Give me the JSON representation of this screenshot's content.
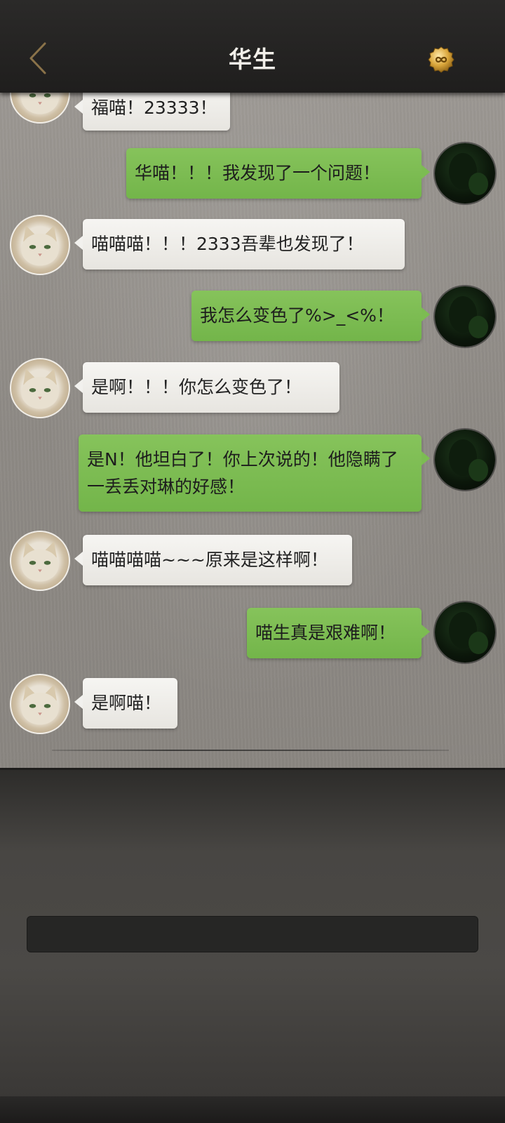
{
  "header": {
    "title": "华生",
    "back_icon": "back-chevron-icon",
    "coin_icon": "gold-infinity-coin-icon"
  },
  "colors": {
    "header_bg": "#232221",
    "chat_bg": "#95918c",
    "bubble_left": "#f2f1ee",
    "bubble_right": "#7cbc52",
    "back_icon": "#8a7249",
    "coin": "#d9a53a"
  },
  "messages": [
    {
      "side": "left",
      "text": "福喵！23333！"
    },
    {
      "side": "right",
      "text": "华喵！！！我发现了一个问题！"
    },
    {
      "side": "left",
      "text": "喵喵喵！！！2333吾辈也发现了！"
    },
    {
      "side": "right",
      "text": "我怎么变色了%>_<%！"
    },
    {
      "side": "left",
      "text": "是啊！！！你怎么变色了！"
    },
    {
      "side": "right",
      "text": "是N！他坦白了！你上次说的！他隐瞒了一丢丢对琳的好感！"
    },
    {
      "side": "left",
      "text": "喵喵喵喵~~~原来是这样啊！"
    },
    {
      "side": "right",
      "text": "喵生真是艰难啊！"
    },
    {
      "side": "left",
      "text": "是啊喵！"
    }
  ],
  "input": {
    "placeholder": ""
  }
}
